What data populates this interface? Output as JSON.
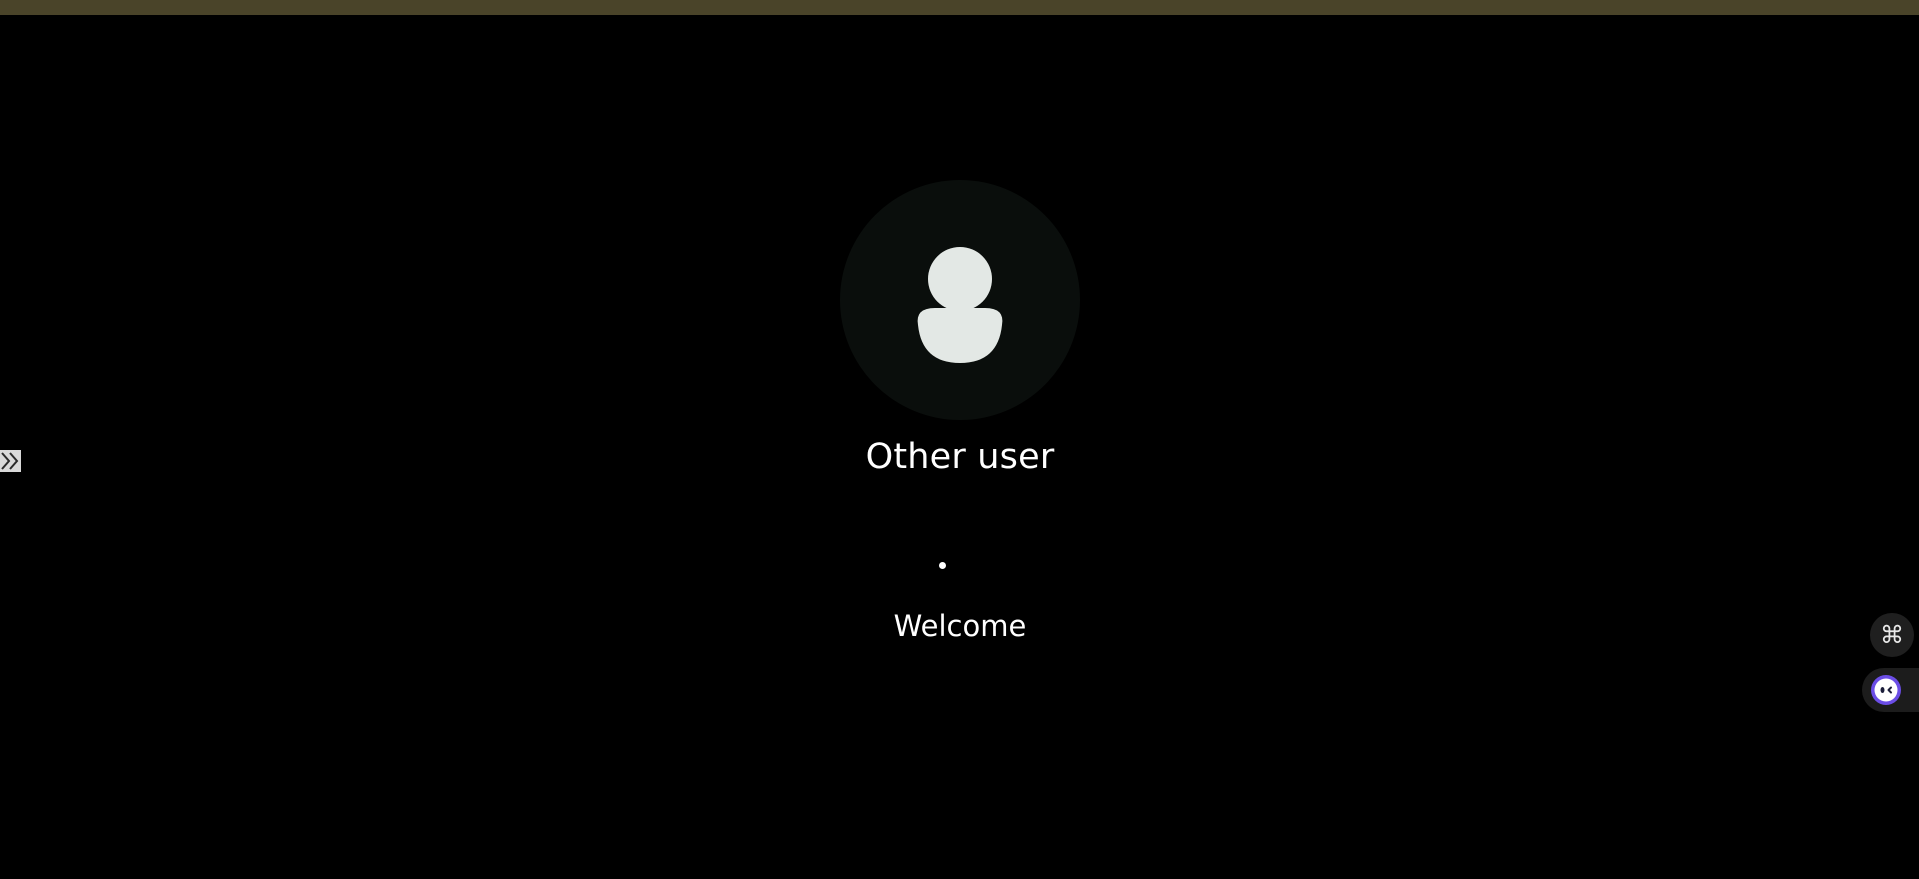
{
  "login": {
    "user_name": "Other user",
    "status_text": "Welcome",
    "avatar_icon": "user-silhouette-icon"
  },
  "overlay": {
    "side_handle_icon": "double-chevron-right-icon",
    "command_icon": "⌘",
    "assistant_icon": "assistant-face-icon"
  },
  "colors": {
    "top_strip": "#4a4429",
    "background": "#000000",
    "avatar_bg": "#0a0e0c",
    "avatar_fg": "#e3e8e5",
    "assistant_ring": "#6b4de6"
  }
}
